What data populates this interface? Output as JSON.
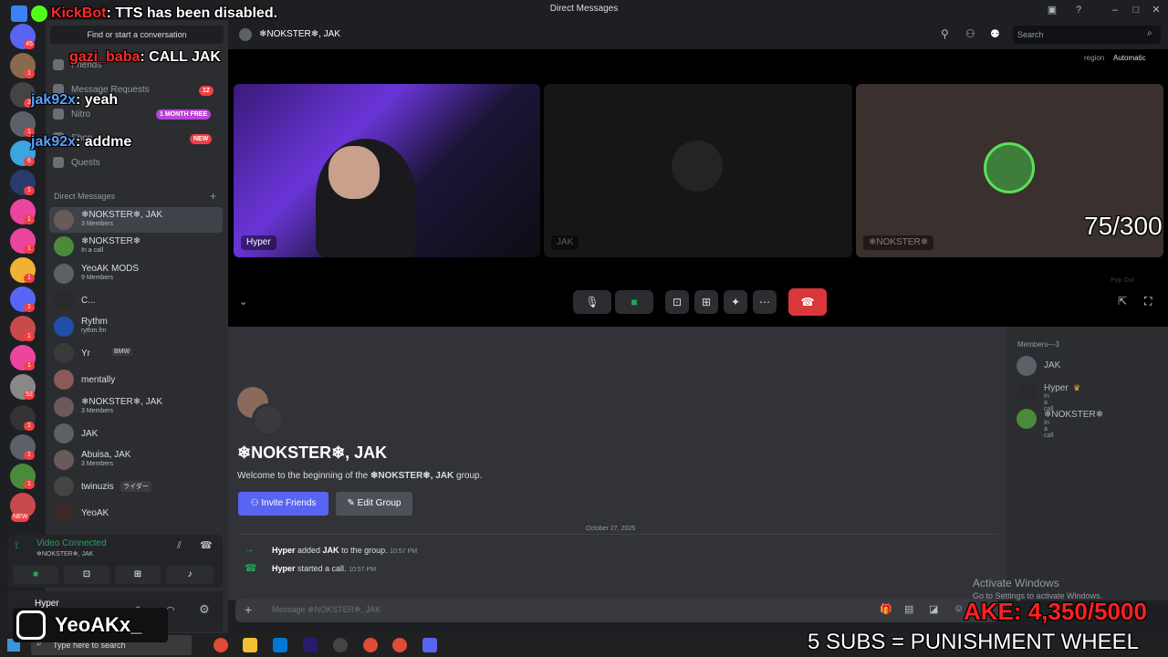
{
  "window": {
    "title": "Direct Messages"
  },
  "sidebar": {
    "find_placeholder": "Find or start a conversation",
    "nav": [
      {
        "label": "Friends"
      },
      {
        "label": "Message Requests",
        "badge": "12"
      },
      {
        "label": "Nitro",
        "badge": "1 MONTH FREE"
      },
      {
        "label": "Shop",
        "badge": "NEW"
      },
      {
        "label": "Quests"
      }
    ],
    "dm_header": "Direct Messages",
    "dms": [
      {
        "name": "❄NOKSTER❄, JAK",
        "sub": "3 Members"
      },
      {
        "name": "❄NOKSTER❄",
        "sub": "In a call"
      },
      {
        "name": "YeoAK MODS",
        "sub": "9 Members"
      },
      {
        "name": "C...",
        "sub": ""
      },
      {
        "name": "Rythm",
        "sub": "rythm.fm"
      },
      {
        "name": "Yr",
        "sub": "",
        "tag": "BMW"
      },
      {
        "name": "mentally",
        "sub": ""
      },
      {
        "name": "❄NOKSTER❄, JAK",
        "sub": "3 Members"
      },
      {
        "name": "JAK",
        "sub": ""
      },
      {
        "name": "Abuisa, JAK",
        "sub": "3 Members"
      },
      {
        "name": "twinuzis",
        "sub": "",
        "tag": "ライダー"
      },
      {
        "name": "YeoAK",
        "sub": ""
      }
    ]
  },
  "rail_badges": [
    "45",
    "1",
    "2",
    "1",
    "6",
    "1",
    "1",
    "1",
    "1",
    "1",
    "1",
    "1",
    "52",
    "1",
    "1",
    "1",
    "NEW"
  ],
  "voice": {
    "status": "Video Connected",
    "channel": "❄NOKSTER❄, JAK"
  },
  "userbar": {
    "name": "Hyper"
  },
  "header": {
    "channel": "❄NOKSTER❄, JAK",
    "search_placeholder": "Search",
    "region_label": "region",
    "region_value": "Automatic"
  },
  "call": {
    "tiles": [
      {
        "label": "Hyper"
      },
      {
        "label": "JAK"
      },
      {
        "label": "❄NOKSTER❄"
      }
    ],
    "popout": "Pop Out"
  },
  "chat": {
    "group_title": "❄NOKSTER❄, JAK",
    "welcome_prefix": "Welcome to the beginning of the ",
    "welcome_group": "❄NOKSTER❄, JAK",
    "welcome_suffix": " group.",
    "invite_btn": "Invite Friends",
    "edit_btn": "Edit Group",
    "date_divider": "October 27, 2025",
    "events": [
      {
        "user": "Hyper",
        "text1": " added ",
        "target": "JAK",
        "text2": " to the group.",
        "time": "10:57 PM"
      },
      {
        "user": "Hyper",
        "text1": " started a call.",
        "target": "",
        "text2": "",
        "time": "10:57 PM"
      }
    ],
    "composer_placeholder": "Message ❄NOKSTER❄, JAK"
  },
  "members": {
    "header": "Members—3",
    "list": [
      {
        "name": "JAK",
        "sub": ""
      },
      {
        "name": "Hyper",
        "sub": "In a call"
      },
      {
        "name": "❄NOKSTER❄",
        "sub": "In a call"
      }
    ]
  },
  "activate": {
    "title": "Activate Windows",
    "sub": "Go to Settings to activate Windows."
  },
  "taskbar": {
    "search": "Type here to search"
  },
  "overlay": {
    "kickbot_name": "KickBot",
    "kickbot_msg": ": TTS has been disabled.",
    "msgs": [
      {
        "user": "gazi_baba",
        "msg": ": CALL JAK"
      },
      {
        "user": "jak92x",
        "msg": ": yeah"
      },
      {
        "user": "jak92x",
        "msg": ": addme"
      }
    ],
    "counter": "75/300",
    "goal": "AKE: 4,350/5000",
    "subs": "5 SUBS = PUNISHMENT WHEEL",
    "instagram": "YeoAKx_"
  },
  "colors": {
    "blurple": "#5865f2",
    "green": "#23a55a",
    "red": "#da373c",
    "nitro": "#b845d8"
  }
}
